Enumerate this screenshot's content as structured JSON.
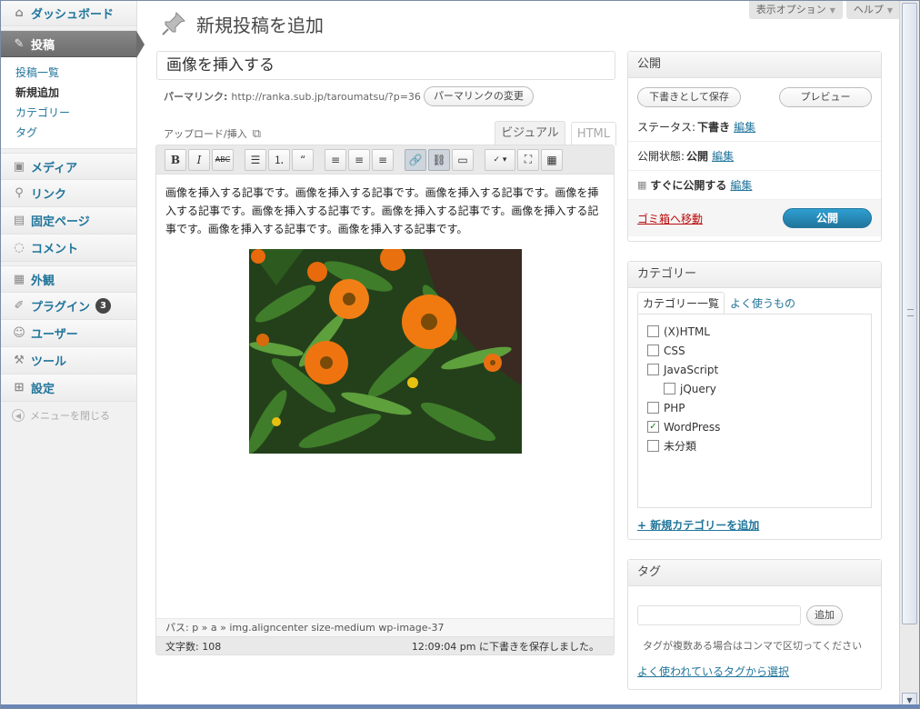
{
  "sidebar": {
    "dashboard": "ダッシュボード",
    "posts": "投稿",
    "posts_sub": [
      "投稿一覧",
      "新規追加",
      "カテゴリー",
      "タグ"
    ],
    "media": "メディア",
    "links": "リンク",
    "pages": "固定ページ",
    "comments": "コメント",
    "appearance": "外観",
    "plugins": "プラグイン",
    "plugins_badge": "3",
    "users": "ユーザー",
    "tools": "ツール",
    "settings": "設定",
    "collapse": "メニューを閉じる"
  },
  "header": {
    "screen_options": "表示オプション",
    "help": "ヘルプ",
    "title": "新規投稿を追加"
  },
  "post": {
    "title_value": "画像を挿入する",
    "permalink_label": "パーマリンク:",
    "permalink_url": "http://ranka.sub.jp/taroumatsu/?p=36",
    "permalink_button": "パーマリンクの変更",
    "upload_label": "アップロード/挿入",
    "tab_visual": "ビジュアル",
    "tab_html": "HTML",
    "body_text": "画像を挿入する記事です。画像を挿入する記事です。画像を挿入する記事です。画像を挿入する記事です。画像を挿入する記事です。画像を挿入する記事です。画像を挿入する記事です。画像を挿入する記事です。画像を挿入する記事です。",
    "path_text": "パス: p » a » img.aligncenter size-medium wp-image-37",
    "word_count": "文字数: 108",
    "autosave": "12:09:04 pm に下書きを保存しました。"
  },
  "publish": {
    "heading": "公開",
    "save_draft": "下書きとして保存",
    "preview": "プレビュー",
    "status_label": "ステータス:",
    "status_value": "下書き",
    "visibility_label": "公開状態:",
    "visibility_value": "公開",
    "schedule": "すぐに公開する",
    "edit": "編集",
    "trash": "ゴミ箱へ移動",
    "publish_button": "公開"
  },
  "categories": {
    "heading": "カテゴリー",
    "tab_all": "カテゴリー一覧",
    "tab_popular": "よく使うもの",
    "items": [
      {
        "label": "(X)HTML",
        "checked": false
      },
      {
        "label": "CSS",
        "checked": false
      },
      {
        "label": "JavaScript",
        "checked": false
      },
      {
        "label": "jQuery",
        "checked": false
      },
      {
        "label": "PHP",
        "checked": false
      },
      {
        "label": "WordPress",
        "checked": true
      },
      {
        "label": "未分類",
        "checked": false
      }
    ],
    "add_new": "+ 新規カテゴリーを追加"
  },
  "tags": {
    "heading": "タグ",
    "add_button": "追加",
    "hint": "タグが複数ある場合はコンマで区切ってください",
    "popular_link": "よく使われているタグから選択"
  },
  "colors": {
    "link": "#21759b",
    "trash": "#bc0b0b",
    "publish_button": "#21759b"
  }
}
